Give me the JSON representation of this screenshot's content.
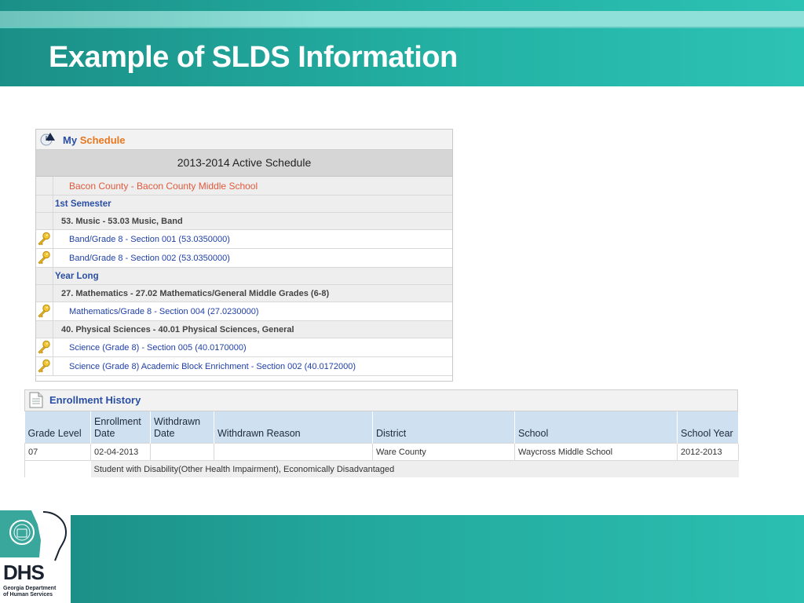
{
  "slide": {
    "title": "Example of SLDS Information"
  },
  "schedule": {
    "header_my": "My",
    "header_schedule": "Schedule",
    "active_label": "2013-2014 Active Schedule",
    "school": "Bacon County - Bacon County Middle School",
    "rows": [
      {
        "type": "semester",
        "label": "1st Semester"
      },
      {
        "type": "course",
        "label": "53. Music - 53.03 Music, Band"
      },
      {
        "type": "section",
        "label": "Band/Grade 8 - Section 001 (53.0350000)"
      },
      {
        "type": "section",
        "label": "Band/Grade 8 - Section 002 (53.0350000)"
      },
      {
        "type": "semester",
        "label": "Year Long"
      },
      {
        "type": "course",
        "label": "27. Mathematics - 27.02 Mathematics/General Middle Grades (6-8)"
      },
      {
        "type": "section",
        "label": "Mathematics/Grade 8 - Section 004 (27.0230000)"
      },
      {
        "type": "course",
        "label": "40. Physical Sciences - 40.01 Physical Sciences, General"
      },
      {
        "type": "section",
        "label": "Science (Grade 8) - Section 005 (40.0170000)"
      },
      {
        "type": "section",
        "label": "Science (Grade 8) Academic Block Enrichment - Section 002 (40.0172000)"
      }
    ]
  },
  "enrollment": {
    "title": "Enrollment History",
    "columns": [
      "Grade Level",
      "Enrollment Date",
      "Withdrawn Date",
      "Withdrawn Reason",
      "District",
      "School",
      "School Year"
    ],
    "row": {
      "grade_level": "07",
      "enrollment_date": "02-04-2013",
      "withdrawn_date": "",
      "withdrawn_reason": "",
      "district": "Ware County",
      "school": "Waycross Middle School",
      "school_year": "2012-2013"
    },
    "note": "Student with Disability(Other Health Impairment), Economically Disadvantaged"
  },
  "logo": {
    "abbr": "DHS",
    "org_line1": "Georgia Department",
    "org_line2": "of Human Services"
  },
  "colors": {
    "teal": "#24b3a6",
    "link_blue": "#1f3fa8",
    "school_red": "#e05a3c",
    "header_orange": "#e8771e"
  }
}
